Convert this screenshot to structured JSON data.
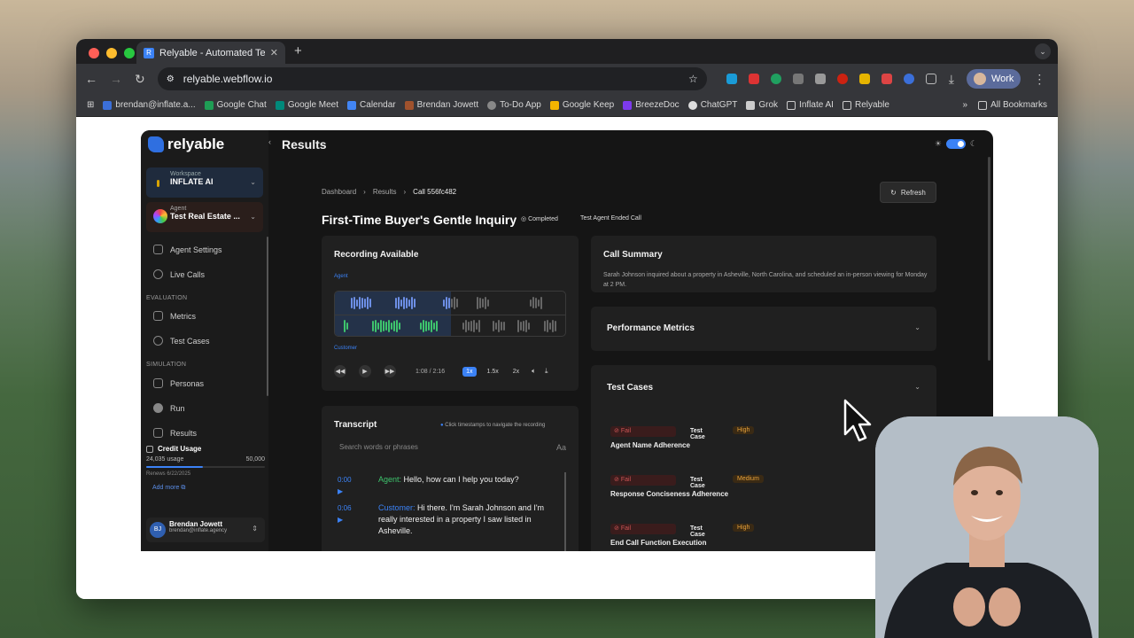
{
  "browser": {
    "tab_title": "Relyable - Automated Testing",
    "url": "relyable.webflow.io",
    "profile": "Work",
    "bookmarks": [
      "brendan@inflate.a...",
      "Google Chat",
      "Google Meet",
      "Calendar",
      "Brendan Jowett",
      "To-Do App",
      "Google Keep",
      "BreezeDoc",
      "ChatGPT",
      "Grok",
      "Inflate AI",
      "Relyable"
    ],
    "all_bookmarks": "All Bookmarks"
  },
  "app": {
    "logo": "relyable",
    "page_title": "Results",
    "workspace": {
      "label": "Workspace",
      "name": "INFLATE AI"
    },
    "agent": {
      "label": "Agent",
      "name": "Test Real Estate ..."
    },
    "nav": {
      "agent_settings": "Agent Settings",
      "live_calls": "Live Calls",
      "evaluation": "EVALUATION",
      "metrics": "Metrics",
      "test_cases": "Test Cases",
      "simulation": "SIMULATION",
      "personas": "Personas",
      "run": "Run",
      "results": "Results"
    },
    "credit": {
      "title": "Credit Usage",
      "used": "24,035 usage",
      "total": "50,000",
      "used_fraction": 0.48,
      "renews": "Renews 6/22/2025",
      "add_more": "Add more"
    },
    "user": {
      "initials": "BJ",
      "name": "Brendan Jowett",
      "email": "brendan@inflate.agency"
    },
    "breadcrumb": [
      "Dashboard",
      "Results",
      "Call 556fc482"
    ],
    "refresh": "Refresh",
    "call_title": "First-Time Buyer's Gentle Inquiry",
    "status_completed": "Completed",
    "status_ended": "Test Agent Ended Call",
    "recording": {
      "title": "Recording Available",
      "agent_label": "Agent",
      "customer_label": "Customer",
      "time": "1:08 / 2:16",
      "speeds": [
        "1x",
        "1.5x",
        "2x"
      ],
      "progress": 0.5
    },
    "transcript": {
      "title": "Transcript",
      "hint": "Click timestamps to navigate the recording",
      "search_placeholder": "Search words or phrases",
      "case_toggle": "Aa",
      "messages": [
        {
          "time": "0:00 ▶",
          "speaker": "Agent:",
          "text": "Hello, how can I help you today?"
        },
        {
          "time": "0:06 ▶",
          "speaker": "Customer:",
          "text": "Hi there. I'm Sarah Johnson and I'm really interested in a property I saw listed in Asheville."
        }
      ]
    },
    "summary": {
      "title": "Call Summary",
      "text": "Sarah Johnson inquired about a property in Asheville, North Carolina, and scheduled an in-person viewing for Monday at 2 PM."
    },
    "performance_metrics": "Performance Metrics",
    "test_cases": {
      "title": "Test Cases",
      "items": [
        {
          "status": "Fail",
          "label": "Test Case",
          "priority": "High",
          "name": "Agent Name Adherence"
        },
        {
          "status": "Fail",
          "label": "Test Case",
          "priority": "Medium",
          "name": "Response Conciseness Adherence"
        },
        {
          "status": "Fail",
          "label": "Test Case",
          "priority": "High",
          "name": "End Call Function Execution"
        }
      ]
    }
  }
}
